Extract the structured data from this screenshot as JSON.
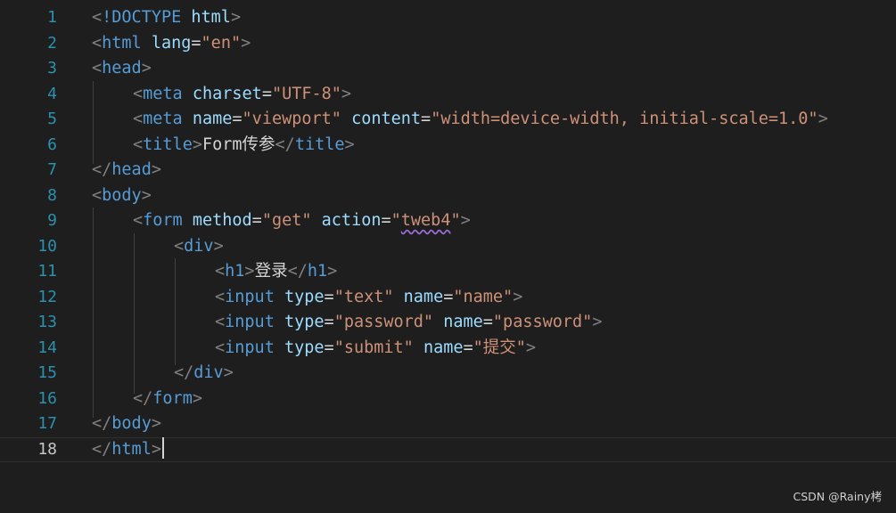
{
  "editor": {
    "language": "html",
    "current_line": 18,
    "lines": [
      {
        "n": "1",
        "indent": 0,
        "tokens": [
          [
            "punct",
            "<"
          ],
          [
            "tag",
            "!DOCTYPE"
          ],
          [
            "text",
            " "
          ],
          [
            "attr",
            "html"
          ],
          [
            "punct",
            ">"
          ]
        ]
      },
      {
        "n": "2",
        "indent": 0,
        "tokens": [
          [
            "punct",
            "<"
          ],
          [
            "tag",
            "html"
          ],
          [
            "text",
            " "
          ],
          [
            "attr",
            "lang"
          ],
          [
            "text",
            "="
          ],
          [
            "str",
            "\"en\""
          ],
          [
            "punct",
            ">"
          ]
        ]
      },
      {
        "n": "3",
        "indent": 0,
        "tokens": [
          [
            "punct",
            "<"
          ],
          [
            "tag",
            "head"
          ],
          [
            "punct",
            ">"
          ]
        ]
      },
      {
        "n": "4",
        "indent": 1,
        "tokens": [
          [
            "punct",
            "<"
          ],
          [
            "tag",
            "meta"
          ],
          [
            "text",
            " "
          ],
          [
            "attr",
            "charset"
          ],
          [
            "text",
            "="
          ],
          [
            "str",
            "\"UTF-8\""
          ],
          [
            "punct",
            ">"
          ]
        ]
      },
      {
        "n": "5",
        "indent": 1,
        "tokens": [
          [
            "punct",
            "<"
          ],
          [
            "tag",
            "meta"
          ],
          [
            "text",
            " "
          ],
          [
            "attr",
            "name"
          ],
          [
            "text",
            "="
          ],
          [
            "str",
            "\"viewport\""
          ],
          [
            "text",
            " "
          ],
          [
            "attr",
            "content"
          ],
          [
            "text",
            "="
          ],
          [
            "str",
            "\"width=device-width, initial-scale=1.0\""
          ],
          [
            "punct",
            ">"
          ]
        ]
      },
      {
        "n": "6",
        "indent": 1,
        "tokens": [
          [
            "punct",
            "<"
          ],
          [
            "tag",
            "title"
          ],
          [
            "punct",
            ">"
          ],
          [
            "text",
            "Form传参"
          ],
          [
            "punct",
            "</"
          ],
          [
            "tag",
            "title"
          ],
          [
            "punct",
            ">"
          ]
        ]
      },
      {
        "n": "7",
        "indent": 0,
        "tokens": [
          [
            "punct",
            "</"
          ],
          [
            "tag",
            "head"
          ],
          [
            "punct",
            ">"
          ]
        ]
      },
      {
        "n": "8",
        "indent": 0,
        "tokens": [
          [
            "punct",
            "<"
          ],
          [
            "tag",
            "body"
          ],
          [
            "punct",
            ">"
          ]
        ]
      },
      {
        "n": "9",
        "indent": 1,
        "tokens": [
          [
            "punct",
            "<"
          ],
          [
            "tag",
            "form"
          ],
          [
            "text",
            " "
          ],
          [
            "attr",
            "method"
          ],
          [
            "text",
            "="
          ],
          [
            "str",
            "\"get\""
          ],
          [
            "text",
            " "
          ],
          [
            "attr",
            "action"
          ],
          [
            "text",
            "="
          ],
          [
            "str",
            "\""
          ],
          [
            "strsq",
            "tweb4"
          ],
          [
            "str",
            "\""
          ],
          [
            "punct",
            ">"
          ]
        ]
      },
      {
        "n": "10",
        "indent": 2,
        "tokens": [
          [
            "punct",
            "<"
          ],
          [
            "tag",
            "div"
          ],
          [
            "punct",
            ">"
          ]
        ]
      },
      {
        "n": "11",
        "indent": 3,
        "tokens": [
          [
            "punct",
            "<"
          ],
          [
            "tag",
            "h1"
          ],
          [
            "punct",
            ">"
          ],
          [
            "text",
            "登录"
          ],
          [
            "punct",
            "</"
          ],
          [
            "tag",
            "h1"
          ],
          [
            "punct",
            ">"
          ]
        ]
      },
      {
        "n": "12",
        "indent": 3,
        "tokens": [
          [
            "punct",
            "<"
          ],
          [
            "tag",
            "input"
          ],
          [
            "text",
            " "
          ],
          [
            "attr",
            "type"
          ],
          [
            "text",
            "="
          ],
          [
            "str",
            "\"text\""
          ],
          [
            "text",
            " "
          ],
          [
            "attr",
            "name"
          ],
          [
            "text",
            "="
          ],
          [
            "str",
            "\"name\""
          ],
          [
            "punct",
            ">"
          ]
        ]
      },
      {
        "n": "13",
        "indent": 3,
        "tokens": [
          [
            "punct",
            "<"
          ],
          [
            "tag",
            "input"
          ],
          [
            "text",
            " "
          ],
          [
            "attr",
            "type"
          ],
          [
            "text",
            "="
          ],
          [
            "str",
            "\"password\""
          ],
          [
            "text",
            " "
          ],
          [
            "attr",
            "name"
          ],
          [
            "text",
            "="
          ],
          [
            "str",
            "\"password\""
          ],
          [
            "punct",
            ">"
          ]
        ]
      },
      {
        "n": "14",
        "indent": 3,
        "tokens": [
          [
            "punct",
            "<"
          ],
          [
            "tag",
            "input"
          ],
          [
            "text",
            " "
          ],
          [
            "attr",
            "type"
          ],
          [
            "text",
            "="
          ],
          [
            "str",
            "\"submit\""
          ],
          [
            "text",
            " "
          ],
          [
            "attr",
            "name"
          ],
          [
            "text",
            "="
          ],
          [
            "str",
            "\"提交\""
          ],
          [
            "punct",
            ">"
          ]
        ]
      },
      {
        "n": "15",
        "indent": 2,
        "tokens": [
          [
            "punct",
            "</"
          ],
          [
            "tag",
            "div"
          ],
          [
            "punct",
            ">"
          ]
        ]
      },
      {
        "n": "16",
        "indent": 1,
        "tokens": [
          [
            "punct",
            "</"
          ],
          [
            "tag",
            "form"
          ],
          [
            "punct",
            ">"
          ]
        ]
      },
      {
        "n": "17",
        "indent": 0,
        "tokens": [
          [
            "punct",
            "</"
          ],
          [
            "tag",
            "body"
          ],
          [
            "punct",
            ">"
          ]
        ]
      },
      {
        "n": "18",
        "indent": 0,
        "tokens": [
          [
            "punct",
            "</"
          ],
          [
            "tag",
            "html"
          ],
          [
            "punct",
            ">"
          ]
        ]
      }
    ]
  },
  "watermark": "CSDN @Rainy栲"
}
